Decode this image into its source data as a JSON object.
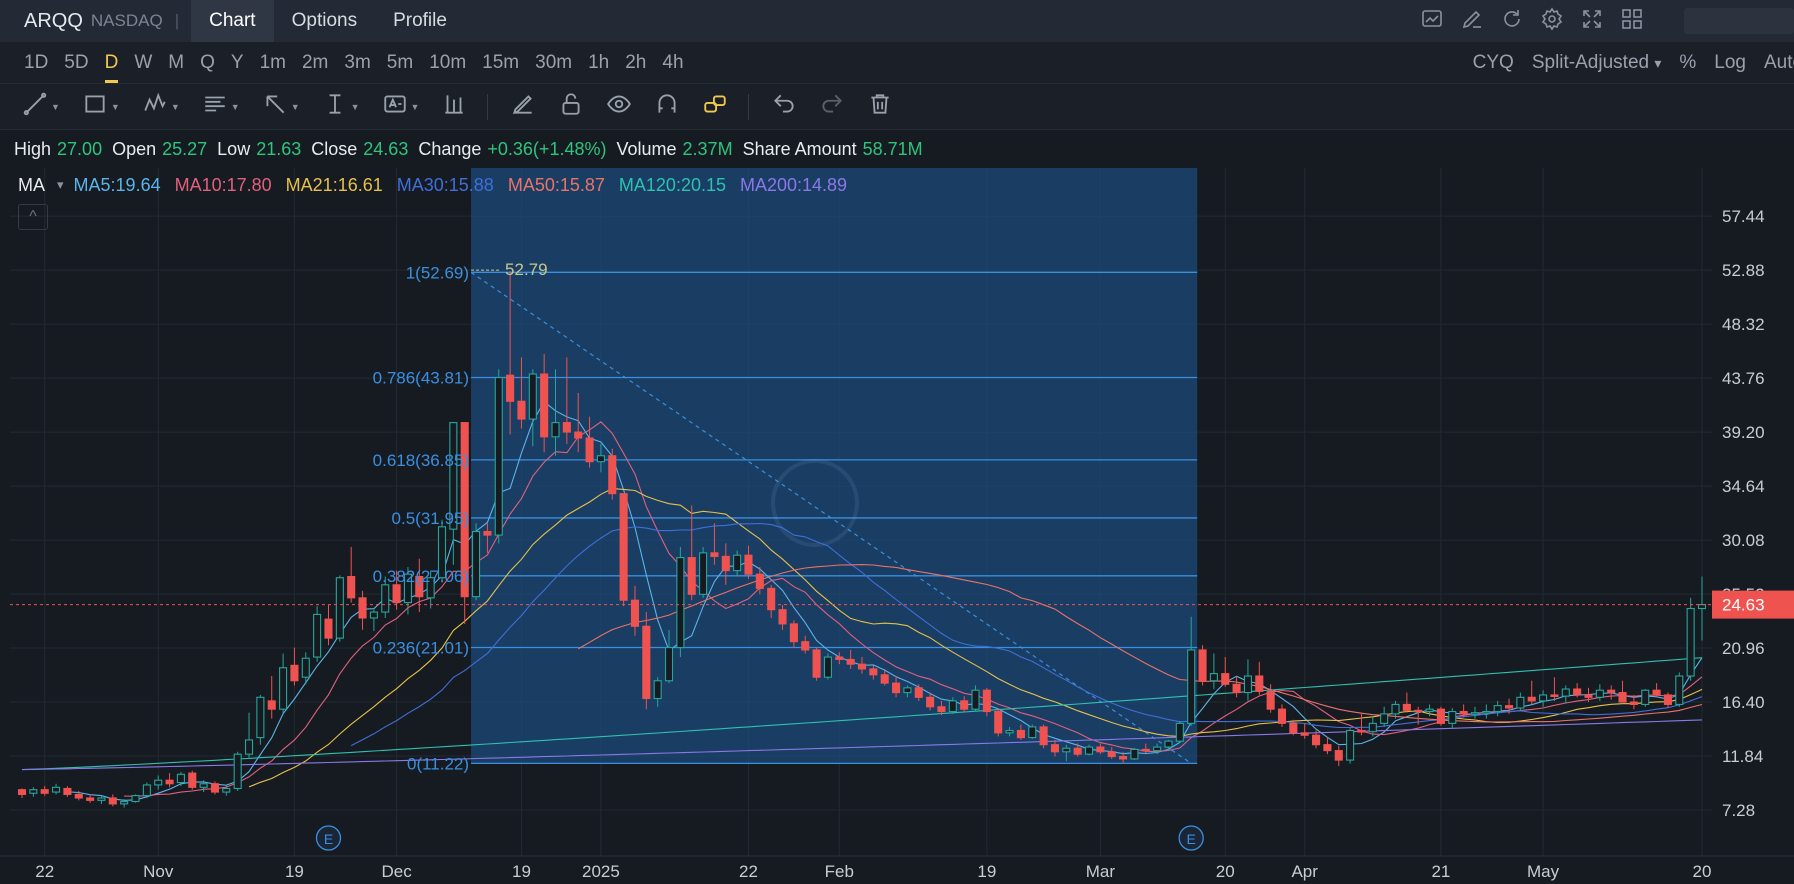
{
  "header": {
    "symbol": "ARQQ",
    "exchange": "NASDAQ",
    "separator": "|",
    "tabs": [
      {
        "label": "Chart",
        "active": true
      },
      {
        "label": "Options",
        "active": false
      },
      {
        "label": "Profile",
        "active": false
      }
    ],
    "icons": [
      "chart-settings-icon",
      "edit-icon",
      "refresh-icon",
      "gear-icon",
      "fullscreen-icon",
      "layout-grid-icon"
    ]
  },
  "periods": [
    "1D",
    "5D",
    "D",
    "W",
    "M",
    "Q",
    "Y",
    "1m",
    "2m",
    "3m",
    "5m",
    "10m",
    "15m",
    "30m",
    "1h",
    "2h",
    "4h"
  ],
  "active_period": "D",
  "right_options": {
    "cyq": "CYQ",
    "adjust": "Split-Adjusted",
    "dropdown_arrow": "▾",
    "percent": "%",
    "log": "Log",
    "auto": "Auto"
  },
  "toolbar_icons": [
    "trend-line-icon",
    "rectangle-icon",
    "pattern-icon",
    "fibonacci-icon",
    "arrow-icon",
    "measure-icon",
    "text-icon",
    "indicator-icon",
    "pencil-icon",
    "lock-icon",
    "eye-icon",
    "magnet-icon",
    "link-icon",
    "undo-icon",
    "redo-icon",
    "trash-icon"
  ],
  "ohlc": {
    "high_label": "High",
    "high": "27.00",
    "open_label": "Open",
    "open": "25.27",
    "low_label": "Low",
    "low": "21.63",
    "close_label": "Close",
    "close": "24.63",
    "change_label": "Change",
    "change": "+0.36(+1.48%)",
    "volume_label": "Volume",
    "volume": "2.37M",
    "amount_label": "Share Amount",
    "amount": "58.71M"
  },
  "ma": {
    "label": "MA",
    "dropdown_arrow": "▾",
    "collapse_glyph": "^",
    "items": [
      {
        "text": "MA5:19.64",
        "color": "#5ab4ea"
      },
      {
        "text": "MA10:17.80",
        "color": "#e0607e"
      },
      {
        "text": "MA21:16.61",
        "color": "#e6c04a"
      },
      {
        "text": "MA30:15.88",
        "color": "#3f6fd8"
      },
      {
        "text": "MA50:15.87",
        "color": "#e8736a"
      },
      {
        "text": "MA120:20.15",
        "color": "#2fc0b0"
      },
      {
        "text": "MA200:14.89",
        "color": "#8a78e8"
      }
    ]
  },
  "colors": {
    "up": "#26a69a",
    "down": "#ef5350",
    "background": "#161b22",
    "grid": "#232a33",
    "fib_zone": "#1c4a7a",
    "fib_line": "#3a8fe0",
    "fib_text": "#3a8fe0",
    "last_price": "#ef5350"
  },
  "chart_data": {
    "type": "candlestick",
    "ylim": [
      7.28,
      61.5
    ],
    "y_axis": [
      "57.44",
      "52.88",
      "48.32",
      "43.76",
      "39.20",
      "34.64",
      "30.08",
      "25.52",
      "20.96",
      "16.40",
      "11.84",
      "7.28"
    ],
    "x_axis": [
      "22",
      "Nov",
      "19",
      "Dec",
      "19",
      "2025",
      "22",
      "Feb",
      "19",
      "Mar",
      "20",
      "Apr",
      "21",
      "May",
      "20"
    ],
    "last_price": "24.63",
    "fibonacci": {
      "start_index": 40,
      "end_index": 103,
      "levels": [
        {
          "label": "1(52.69)",
          "value": 52.69
        },
        {
          "label": "0.786(43.81)",
          "value": 43.81
        },
        {
          "label": "0.618(36.85)",
          "value": 36.85
        },
        {
          "label": "0.5(31.95)",
          "value": 31.95
        },
        {
          "label": "0.382(27.06)",
          "value": 27.06
        },
        {
          "label": "0.236(21.01)",
          "value": 21.01
        },
        {
          "label": "0(11.22)",
          "value": 11.22
        }
      ],
      "high_marker": "52.79"
    },
    "earnings_markers": [
      {
        "label": "E",
        "index": 27
      },
      {
        "label": "E",
        "index": 103
      }
    ],
    "candles": [
      [
        9,
        9.1,
        8.3,
        8.6
      ],
      [
        8.7,
        9.2,
        8.4,
        9.0
      ],
      [
        9.0,
        9.3,
        8.5,
        8.7
      ],
      [
        8.8,
        9.5,
        8.6,
        9.2
      ],
      [
        9.1,
        9.3,
        8.4,
        8.6
      ],
      [
        8.6,
        8.9,
        8.1,
        8.3
      ],
      [
        8.3,
        8.6,
        7.9,
        8.1
      ],
      [
        8.1,
        8.5,
        7.8,
        8.3
      ],
      [
        8.3,
        8.6,
        7.6,
        7.8
      ],
      [
        7.8,
        8.2,
        7.5,
        8.0
      ],
      [
        8.0,
        8.6,
        7.9,
        8.5
      ],
      [
        8.5,
        9.6,
        8.3,
        9.4
      ],
      [
        9.4,
        10.2,
        9.0,
        9.8
      ],
      [
        9.8,
        10.4,
        9.2,
        9.5
      ],
      [
        9.6,
        10.5,
        9.3,
        10.3
      ],
      [
        10.4,
        10.6,
        9.0,
        9.2
      ],
      [
        9.2,
        9.8,
        8.8,
        9.5
      ],
      [
        9.5,
        9.7,
        8.6,
        8.8
      ],
      [
        8.8,
        9.4,
        8.5,
        9.1
      ],
      [
        9.1,
        12.2,
        8.9,
        12.0
      ],
      [
        12.0,
        15.5,
        11.6,
        13.2
      ],
      [
        13.4,
        17.0,
        12.8,
        16.8
      ],
      [
        16.5,
        18.6,
        15.0,
        15.8
      ],
      [
        15.8,
        20.5,
        15.5,
        19.3
      ],
      [
        19.5,
        21.0,
        17.8,
        18.2
      ],
      [
        18.5,
        20.6,
        17.9,
        20.1
      ],
      [
        20.2,
        24.5,
        19.8,
        23.8
      ],
      [
        23.4,
        24.6,
        21.2,
        21.8
      ],
      [
        21.8,
        27.1,
        21.5,
        26.9
      ],
      [
        27.0,
        29.5,
        24.8,
        25.2
      ],
      [
        25.2,
        25.8,
        22.5,
        23.5
      ],
      [
        23.5,
        24.2,
        22.4,
        24.0
      ],
      [
        24.0,
        27.0,
        23.5,
        26.3
      ],
      [
        26.3,
        27.5,
        24.2,
        24.8
      ],
      [
        24.8,
        27.8,
        23.8,
        27.2
      ],
      [
        27.0,
        28.5,
        24.0,
        25.3
      ],
      [
        25.2,
        27.5,
        24.3,
        26.9
      ],
      [
        26.9,
        31.8,
        26.5,
        31.2
      ],
      [
        31.0,
        40.0,
        28.0,
        40.0
      ],
      [
        40.0,
        34.0,
        23.0,
        25.3
      ],
      [
        25.3,
        31.5,
        25.0,
        30.8
      ],
      [
        30.8,
        31.5,
        29.0,
        30.5
      ],
      [
        30.5,
        44.5,
        29.8,
        43.8
      ],
      [
        44.0,
        52.79,
        39.0,
        41.8
      ],
      [
        41.8,
        45.5,
        39.5,
        40.3
      ],
      [
        40.3,
        44.5,
        38.0,
        44.1
      ],
      [
        44.1,
        45.8,
        37.5,
        38.8
      ],
      [
        38.8,
        44.5,
        37.2,
        40.0
      ],
      [
        40.0,
        45.5,
        38.2,
        39.2
      ],
      [
        39.2,
        42.5,
        37.5,
        38.7
      ],
      [
        38.7,
        40.5,
        36.2,
        36.7
      ],
      [
        36.7,
        38.2,
        35.8,
        37.2
      ],
      [
        37.2,
        37.8,
        33.5,
        34.0
      ],
      [
        34.0,
        31.0,
        24.5,
        25.0
      ],
      [
        25.0,
        26.2,
        22.0,
        22.8
      ],
      [
        22.8,
        24.0,
        15.8,
        16.7
      ],
      [
        16.7,
        18.5,
        16.0,
        18.2
      ],
      [
        18.2,
        22.5,
        18.0,
        21.0
      ],
      [
        21.0,
        29.5,
        20.2,
        28.6
      ],
      [
        28.6,
        33.0,
        25.0,
        25.5
      ],
      [
        25.5,
        29.5,
        25.2,
        29.0
      ],
      [
        29.0,
        31.5,
        28.0,
        28.7
      ],
      [
        28.7,
        29.8,
        26.3,
        27.5
      ],
      [
        27.5,
        29.2,
        27.0,
        28.8
      ],
      [
        28.8,
        29.6,
        26.8,
        27.2
      ],
      [
        27.2,
        27.8,
        25.5,
        26.0
      ],
      [
        26.0,
        26.3,
        23.5,
        24.2
      ],
      [
        24.2,
        24.6,
        22.5,
        23.0
      ],
      [
        23.0,
        23.3,
        21.0,
        21.5
      ],
      [
        21.5,
        22.0,
        20.5,
        20.8
      ],
      [
        20.8,
        21.0,
        18.2,
        18.5
      ],
      [
        18.5,
        20.5,
        18.3,
        20.2
      ],
      [
        20.2,
        20.6,
        19.6,
        20.0
      ],
      [
        20.0,
        20.8,
        19.2,
        19.6
      ],
      [
        19.6,
        20.2,
        18.8,
        19.2
      ],
      [
        19.2,
        19.5,
        18.3,
        18.7
      ],
      [
        18.7,
        19.2,
        17.8,
        18.0
      ],
      [
        18.0,
        18.6,
        16.8,
        17.2
      ],
      [
        17.2,
        17.8,
        16.8,
        17.6
      ],
      [
        17.6,
        17.9,
        16.5,
        16.8
      ],
      [
        16.8,
        17.2,
        15.7,
        16.0
      ],
      [
        16.0,
        16.5,
        15.3,
        15.6
      ],
      [
        15.6,
        16.8,
        15.4,
        16.5
      ],
      [
        16.5,
        16.9,
        15.5,
        15.8
      ],
      [
        15.8,
        17.8,
        15.6,
        17.4
      ],
      [
        17.4,
        17.6,
        15.2,
        15.6
      ],
      [
        15.6,
        15.9,
        13.5,
        13.8
      ],
      [
        13.8,
        14.3,
        13.5,
        14.0
      ],
      [
        14.0,
        14.5,
        13.2,
        13.4
      ],
      [
        13.4,
        14.5,
        13.3,
        14.3
      ],
      [
        14.3,
        14.5,
        12.5,
        12.8
      ],
      [
        12.8,
        13.2,
        11.8,
        12.2
      ],
      [
        12.2,
        12.8,
        11.4,
        12.5
      ],
      [
        12.5,
        12.9,
        11.8,
        12.0
      ],
      [
        12.0,
        12.8,
        11.9,
        12.6
      ],
      [
        12.6,
        12.9,
        12.0,
        12.2
      ],
      [
        12.2,
        12.6,
        11.6,
        11.8
      ],
      [
        11.8,
        12.2,
        11.2,
        11.6
      ],
      [
        11.6,
        12.5,
        11.5,
        12.4
      ],
      [
        12.4,
        12.9,
        12.1,
        12.3
      ],
      [
        12.3,
        12.9,
        12.0,
        12.6
      ],
      [
        12.6,
        13.2,
        12.3,
        13.1
      ],
      [
        13.1,
        14.8,
        13.0,
        14.6
      ],
      [
        14.6,
        23.6,
        14.4,
        20.8
      ],
      [
        20.8,
        21.2,
        17.8,
        18.2
      ],
      [
        18.2,
        20.5,
        17.5,
        18.8
      ],
      [
        18.8,
        20.2,
        17.7,
        17.9
      ],
      [
        17.9,
        18.6,
        16.8,
        17.2
      ],
      [
        17.2,
        20.0,
        16.5,
        18.6
      ],
      [
        18.6,
        19.8,
        17.0,
        17.3
      ],
      [
        17.3,
        17.9,
        15.5,
        15.8
      ],
      [
        15.8,
        16.2,
        14.3,
        14.6
      ],
      [
        14.6,
        14.9,
        13.6,
        13.8
      ],
      [
        13.8,
        14.6,
        13.3,
        13.6
      ],
      [
        13.6,
        14.0,
        12.5,
        12.8
      ],
      [
        12.8,
        13.4,
        12.0,
        12.3
      ],
      [
        12.3,
        12.7,
        11.0,
        11.5
      ],
      [
        11.5,
        14.2,
        11.2,
        14.0
      ],
      [
        14.0,
        15.5,
        13.6,
        13.9
      ],
      [
        13.9,
        15.2,
        13.5,
        14.6
      ],
      [
        14.6,
        16.0,
        14.3,
        15.4
      ],
      [
        15.4,
        16.5,
        15.0,
        16.2
      ],
      [
        16.2,
        17.2,
        15.5,
        15.7
      ],
      [
        15.7,
        16.0,
        14.5,
        15.6
      ],
      [
        15.6,
        16.2,
        15.2,
        15.8
      ],
      [
        15.8,
        16.0,
        14.4,
        14.6
      ],
      [
        14.6,
        15.9,
        14.2,
        15.6
      ],
      [
        15.6,
        16.2,
        15.1,
        15.4
      ],
      [
        15.4,
        16.0,
        15.0,
        15.5
      ],
      [
        15.5,
        16.2,
        15.0,
        15.6
      ],
      [
        15.6,
        16.5,
        15.2,
        16.1
      ],
      [
        16.1,
        16.7,
        15.4,
        15.9
      ],
      [
        15.9,
        17.2,
        15.7,
        16.8
      ],
      [
        16.8,
        18.2,
        16.2,
        16.5
      ],
      [
        16.5,
        17.4,
        16.0,
        17.0
      ],
      [
        17.0,
        18.5,
        16.5,
        16.9
      ],
      [
        16.9,
        17.8,
        16.3,
        17.5
      ],
      [
        17.5,
        18.0,
        16.8,
        17.0
      ],
      [
        17.0,
        17.6,
        16.4,
        16.8
      ],
      [
        16.8,
        17.9,
        16.5,
        17.4
      ],
      [
        17.4,
        17.8,
        16.6,
        17.2
      ],
      [
        17.2,
        18.2,
        16.9,
        16.4
      ],
      [
        16.4,
        17.0,
        15.8,
        16.2
      ],
      [
        16.2,
        17.5,
        16.0,
        17.4
      ],
      [
        17.4,
        18.0,
        16.8,
        17.0
      ],
      [
        17.0,
        17.2,
        15.9,
        16.2
      ],
      [
        16.2,
        18.9,
        16.0,
        18.6
      ],
      [
        18.6,
        25.2,
        18.2,
        24.3
      ],
      [
        24.3,
        27.0,
        21.6,
        24.63
      ]
    ],
    "ma_series": [
      {
        "name": "MA5",
        "color": "#5ab4ea",
        "period": 5
      },
      {
        "name": "MA10",
        "color": "#e0607e",
        "period": 10
      },
      {
        "name": "MA21",
        "color": "#e6c04a",
        "period": 21
      },
      {
        "name": "MA30",
        "color": "#3f6fd8",
        "period": 30
      },
      {
        "name": "MA50",
        "color": "#e8736a",
        "period": 50
      },
      {
        "name": "MA120",
        "color": "#2fc0b0",
        "period": 120,
        "start": 10.7,
        "end": 20.15
      },
      {
        "name": "MA200",
        "color": "#8a78e8",
        "period": 200,
        "start": 10.7,
        "end": 14.89
      }
    ]
  }
}
